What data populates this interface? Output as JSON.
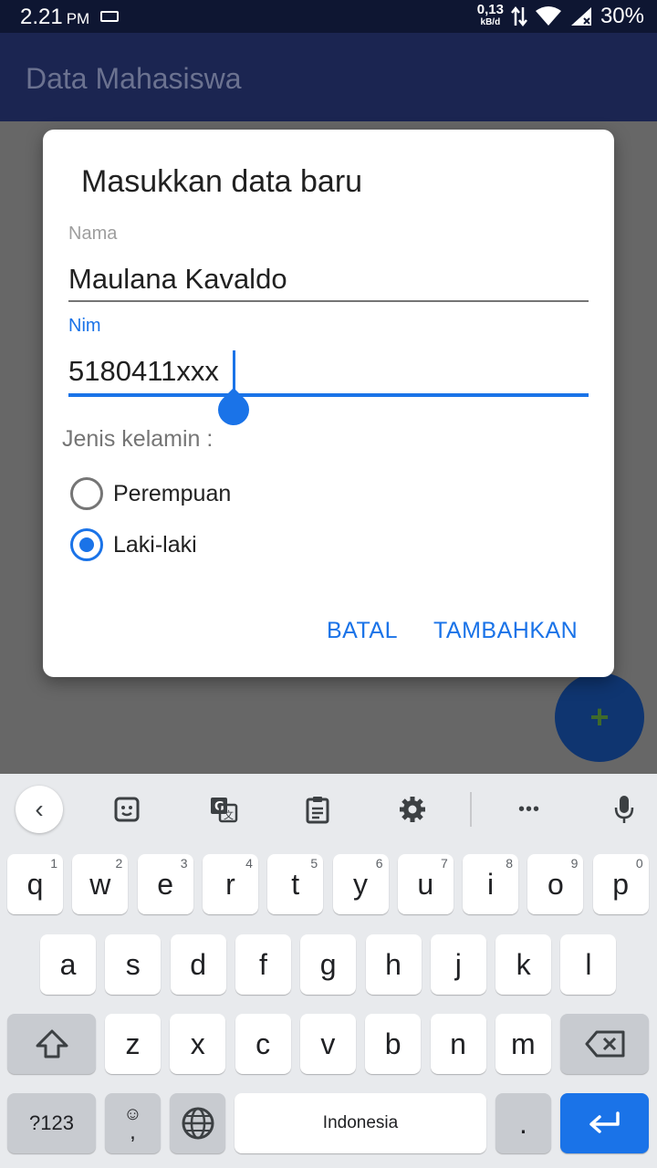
{
  "status_bar": {
    "time": "2.21",
    "ampm": "PM",
    "net_speed": "0,13",
    "net_unit": "kB/d",
    "battery": "30%",
    "icons": [
      "keyboard-icon",
      "data-arrows-icon",
      "wifi-icon",
      "signal-icon"
    ]
  },
  "app_bar": {
    "title": "Data Mahasiswa"
  },
  "fab": {
    "icon": "+",
    "icon_name": "add-icon"
  },
  "dialog": {
    "title": "Masukkan data baru",
    "nama_label": "Nama",
    "nama_value": "Maulana Kavaldo",
    "nim_label": "Nim",
    "nim_value": "5180411xxx",
    "gender_label": "Jenis kelamin :",
    "options": [
      {
        "label": "Perempuan",
        "checked": false
      },
      {
        "label": "Laki-laki",
        "checked": true
      }
    ],
    "cancel": "BATAL",
    "confirm": "TAMBAHKAN"
  },
  "keyboard": {
    "toolbar": {
      "back": "‹",
      "more": "•••"
    },
    "row1": [
      {
        "k": "q",
        "h": "1"
      },
      {
        "k": "w",
        "h": "2"
      },
      {
        "k": "e",
        "h": "3"
      },
      {
        "k": "r",
        "h": "4"
      },
      {
        "k": "t",
        "h": "5"
      },
      {
        "k": "y",
        "h": "6"
      },
      {
        "k": "u",
        "h": "7"
      },
      {
        "k": "i",
        "h": "8"
      },
      {
        "k": "o",
        "h": "9"
      },
      {
        "k": "p",
        "h": "0"
      }
    ],
    "row2": [
      "a",
      "s",
      "d",
      "f",
      "g",
      "h",
      "j",
      "k",
      "l"
    ],
    "row3": [
      "z",
      "x",
      "c",
      "v",
      "b",
      "n",
      "m"
    ],
    "symbols": "?123",
    "comma": ",",
    "emoji": "☺",
    "space": "Indonesia",
    "period": ".",
    "colors": {
      "accent": "#1a73e8",
      "appbar": "#1b2551",
      "statusbar": "#0e1632"
    }
  }
}
